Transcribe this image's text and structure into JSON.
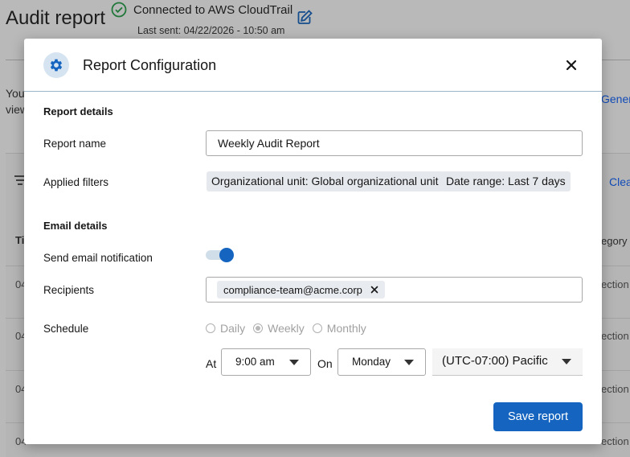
{
  "background": {
    "page_title": "Audit report",
    "connection_status": "Connected to AWS CloudTrail",
    "last_sent": "Last sent: 04/22/2026 - 10:50 am",
    "intro_fragment": "You",
    "intro_fragment_2": "view",
    "generate_fragment": "Gener",
    "clear_fragment": "Clea",
    "table_header_fragment": "Ti",
    "category_fragment": "egory",
    "row_date_fragment": "04",
    "row_category_fragment": "ection"
  },
  "modal": {
    "title": "Report Configuration",
    "report_details": {
      "heading": "Report details",
      "name_label": "Report name",
      "name_value": "Weekly Audit Report",
      "filters_label": "Applied filters",
      "filters": [
        "Organizational unit: Global organizational unit",
        "Date range: Last 7 days"
      ]
    },
    "email_details": {
      "heading": "Email details",
      "notify_label": "Send email notification",
      "notify_enabled": true,
      "recipients_label": "Recipients",
      "recipients": [
        "compliance-team@acme.corp"
      ],
      "schedule_label": "Schedule",
      "schedule_options": [
        "Daily",
        "Weekly",
        "Monthly"
      ],
      "schedule_selected": "Weekly",
      "at_label": "At",
      "time_value": "9:00 am",
      "on_label": "On",
      "day_value": "Monday",
      "timezone_value": "(UTC-07:00) Pacific"
    },
    "save_label": "Save report"
  },
  "colors": {
    "primary": "#1565c0",
    "success": "#24a148",
    "overlay": "rgba(22,22,22,0.30)"
  }
}
